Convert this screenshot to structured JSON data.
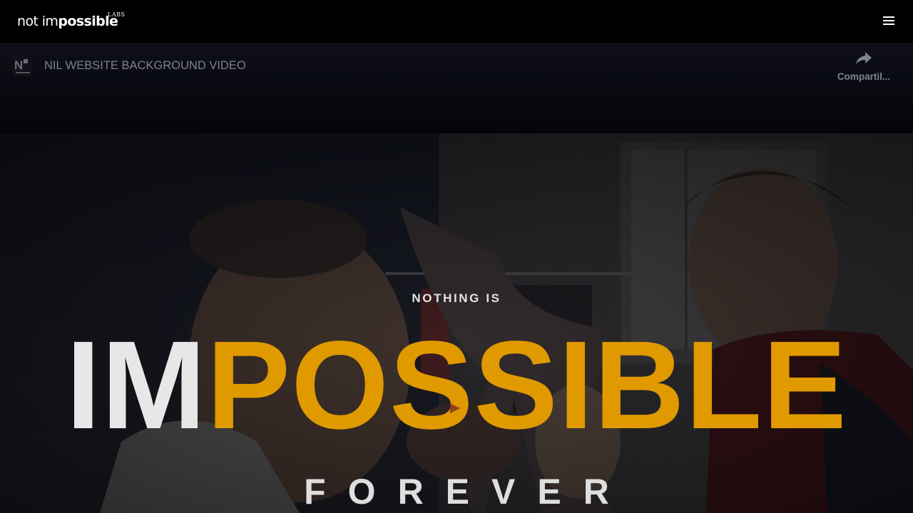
{
  "header": {
    "logo": {
      "part1": "not im",
      "part2": "possible",
      "suffix": "LABS"
    },
    "menu_icon": "hamburger-menu-icon"
  },
  "video": {
    "channel_icon": "channel-logo-icon",
    "channel_mark": "N",
    "title": "NIL WEBSITE BACKGROUND VIDEO",
    "share": {
      "label": "Compartil...",
      "icon": "share-arrow-icon"
    },
    "play_icon": "play-icon"
  },
  "hero": {
    "kicker": "NOTHING IS",
    "headline_white": "IM",
    "headline_orange": "POSSIBLE",
    "tagline": "FOREVER"
  },
  "colors": {
    "accent": "#E09A00",
    "text_light": "#E7E7E7",
    "header_bg": "#000000"
  }
}
